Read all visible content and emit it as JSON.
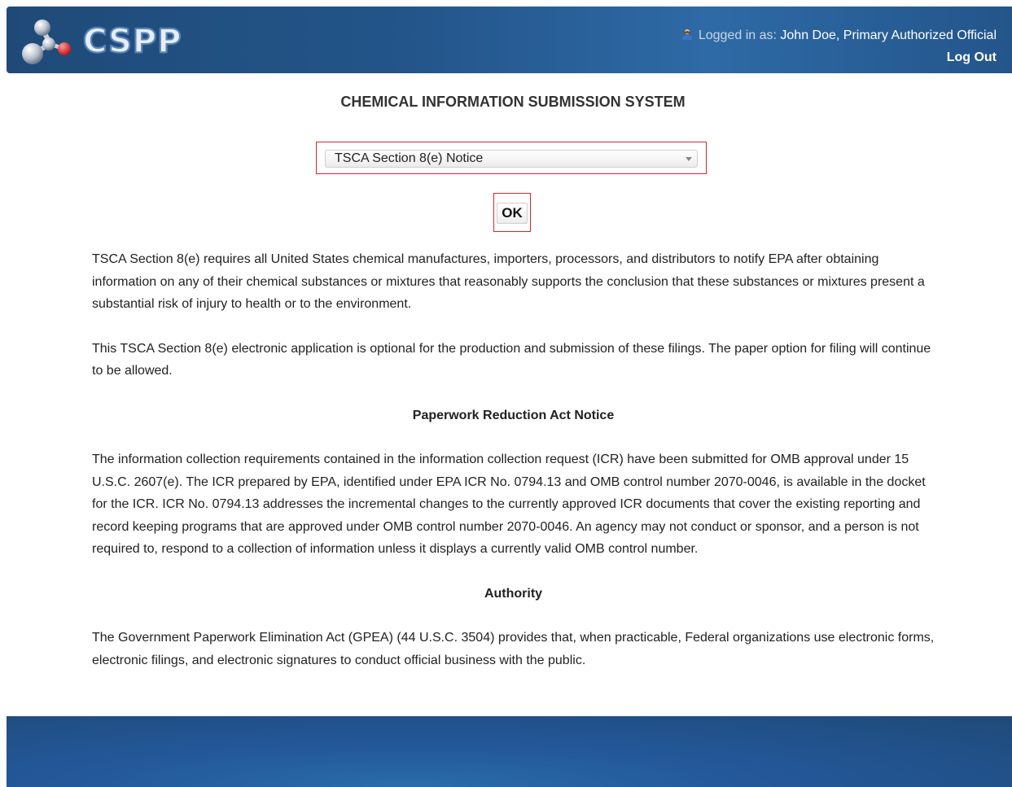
{
  "header": {
    "logo_text": "CSPP",
    "logged_in_prefix": "Logged in as:",
    "user_name": "John Doe, Primary Authorized Official",
    "logout_label": "Log Out",
    "user_icon": "user-icon"
  },
  "main": {
    "title": "CHEMICAL INFORMATION SUBMISSION SYSTEM",
    "select": {
      "selected_value": "TSCA Section 8(e) Notice"
    },
    "ok_label": "OK",
    "paragraphs": {
      "intro": "TSCA Section 8(e) requires all United States chemical manufactures, importers, processors, and distributors to notify EPA after obtaining information on any of their chemical substances or mixtures that reasonably supports the conclusion that these substances or mixtures present a substantial risk of injury to health or to the environment.",
      "optional": "This TSCA Section 8(e) electronic application is optional for the production and submission of these filings. The paper option for filing will continue to be allowed.",
      "pra_heading": "Paperwork Reduction Act Notice",
      "pra_text": "The information collection requirements contained in the information collection request (ICR) have been submitted for OMB approval under 15 U.S.C. 2607(e). The ICR prepared by EPA, identified under EPA ICR No. 0794.13 and OMB control number 2070-0046, is available in the docket for the ICR. ICR No. 0794.13 addresses the incremental changes to the currently approved ICR documents that cover the existing reporting and record keeping programs that are approved under OMB control number 2070-0046. An agency may not conduct or sponsor, and a person is not required to, respond to a collection of information unless it displays a currently valid OMB control number.",
      "authority_heading": "Authority",
      "authority_text": "The Government Paperwork Elimination Act (GPEA) (44 U.S.C. 3504) provides that, when practicable, Federal organizations use electronic forms, electronic filings, and electronic signatures to conduct official business with the public."
    }
  },
  "colors": {
    "header_blue": "#23558a",
    "highlight_red": "#d9262c"
  }
}
